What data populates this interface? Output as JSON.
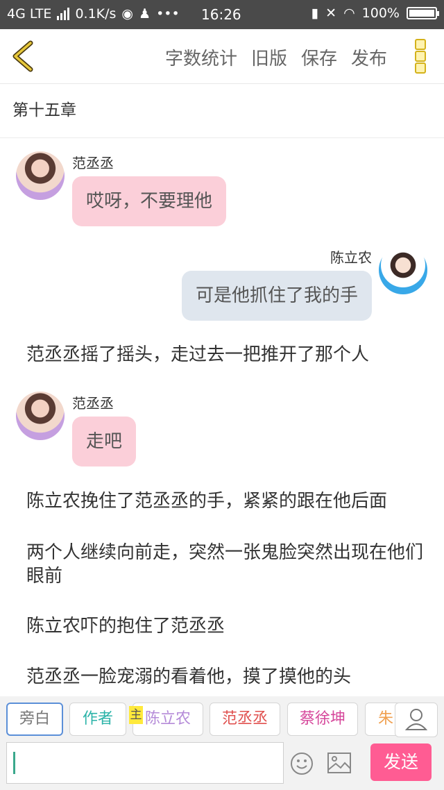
{
  "status_bar": {
    "network": "4G LTE",
    "speed": "0.1K/s",
    "time": "16:26",
    "battery": "100%"
  },
  "header": {
    "actions": [
      "字数统计",
      "旧版",
      "保存",
      "发布"
    ],
    "accent_color": "#d4b21a"
  },
  "chapter": {
    "title": "第十五章"
  },
  "chat": [
    {
      "type": "msg",
      "speaker": "范丞丞",
      "side": "left",
      "text": "哎呀，不要理他"
    },
    {
      "type": "msg",
      "speaker": "陈立农",
      "side": "right",
      "text": "可是他抓住了我的手"
    },
    {
      "type": "narration",
      "text": "范丞丞摇了摇头，走过去一把推开了那个人"
    },
    {
      "type": "msg",
      "speaker": "范丞丞",
      "side": "left",
      "text": "走吧"
    },
    {
      "type": "narration",
      "text": "陈立农挽住了范丞丞的手，紧紧的跟在他后面"
    },
    {
      "type": "narration",
      "text": "两个人继续向前走，突然一张鬼脸突然出现在他们眼前"
    },
    {
      "type": "narration",
      "text": "陈立农吓的抱住了范丞丞"
    },
    {
      "type": "narration",
      "text": "范丞丞一脸宠溺的看着他，摸了摸他的头"
    }
  ],
  "roles": [
    {
      "label": "旁白",
      "color": "#777777",
      "active": true
    },
    {
      "label": "作者",
      "color": "#2bb3a8"
    },
    {
      "label": "陈立农",
      "color": "#b48ad8",
      "tag": "主"
    },
    {
      "label": "范丞丞",
      "color": "#e0504e"
    },
    {
      "label": "蔡徐坤",
      "color": "#d6479b"
    },
    {
      "label": "朱",
      "color": "#f0a050"
    }
  ],
  "input": {
    "value": "",
    "send_label": "发送"
  }
}
